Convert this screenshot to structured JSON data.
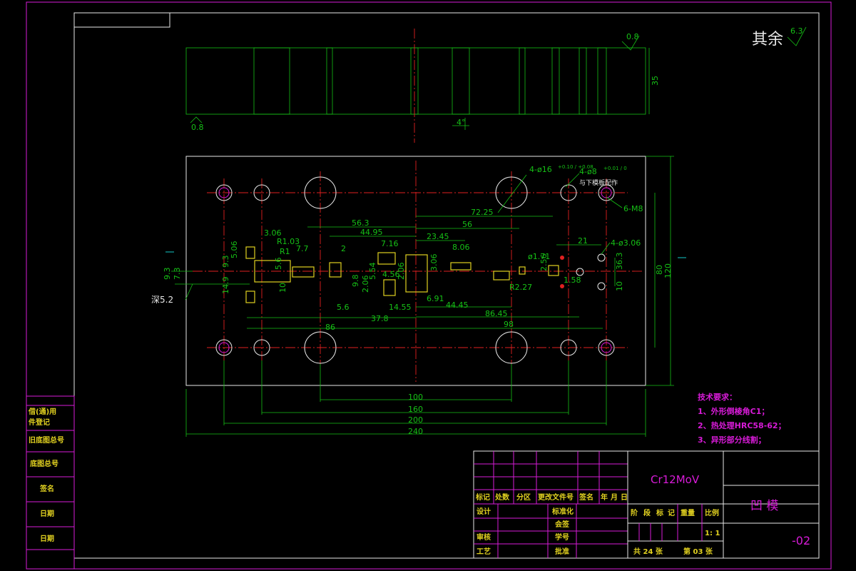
{
  "roughness": {
    "label": "其余",
    "value": "6.3"
  },
  "section_view": {
    "roughness_top": "0.8",
    "roughness_bottom": "0.8",
    "height_dim": "35",
    "angle_dim": "4°"
  },
  "plan_view": {
    "dims": [
      "56.3",
      "44.95",
      "23.45",
      "56",
      "72.25",
      "3.06",
      "R1.03",
      "R1",
      "7.7",
      "2",
      "7.16",
      "8.06",
      "5.06",
      "9.3",
      "7.3",
      "14.9",
      "9.3",
      "5.6",
      "10",
      "9.8",
      "5.54",
      "4.56",
      "2.06",
      "2.06",
      "3.06",
      "6.91",
      "ø1.71",
      "2.56",
      "R2.27",
      "5.6",
      "14.55",
      "37.8",
      "44.45",
      "86.45",
      "86",
      "98",
      "21",
      "4-ø3.06",
      "1.58",
      "10",
      "36.3",
      "80",
      "120",
      "100",
      "160",
      "200",
      "240"
    ],
    "hole_callout_1": "4-ø16",
    "hole_callout_1_tol": "+0.10 / +0.08",
    "hole_callout_2": "4-ø8",
    "hole_callout_2_tol": "+0.01 / 0",
    "hole_note": "与下模板配作",
    "thread_callout": "6-M8",
    "depth_note": "深5.2"
  },
  "tech_requirements": {
    "title": "技术要求：",
    "items": [
      "1、外形倒棱角C1；",
      "2、热处理HRC58-62；",
      "3、异形部分线割；"
    ]
  },
  "left_strip": [
    "借(通)用",
    "件登记",
    "旧底图总号",
    "底图总号",
    "签名",
    "日期",
    "日期"
  ],
  "title_block": {
    "material": "Cr12MoV",
    "part_name": "凹  模",
    "drawing_no": "-02",
    "header_labels": [
      "标记",
      "处数",
      "分区",
      "更改文件号",
      "签名",
      "年",
      "月",
      "日"
    ],
    "row_labels_left": [
      "设计",
      "审核",
      "工艺"
    ],
    "row_labels_mid": [
      "标准化",
      "会签",
      "学号",
      "批准"
    ],
    "stage_labels": [
      "阶",
      "段",
      "标",
      "记",
      "重量",
      "比例"
    ],
    "scale": "1: 1",
    "sheet_total": "共 24  张",
    "sheet_no": "第 03  张"
  }
}
